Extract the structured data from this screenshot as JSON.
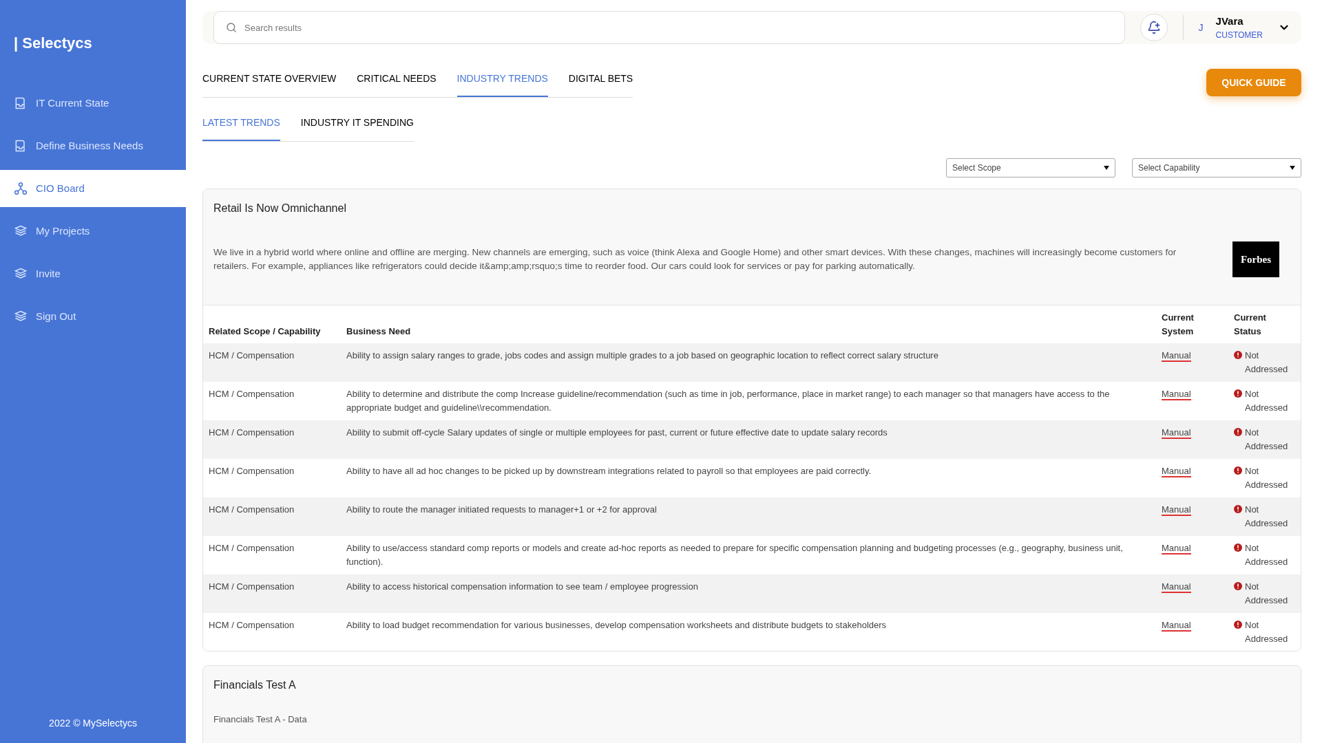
{
  "sidebar": {
    "brand": "| Selectycs",
    "items": [
      {
        "label": "IT Current State",
        "selected": false
      },
      {
        "label": "Define Business Needs",
        "selected": false
      },
      {
        "label": "CIO Board",
        "selected": true
      },
      {
        "label": "My Projects",
        "selected": false
      },
      {
        "label": "Invite",
        "selected": false
      },
      {
        "label": "Sign Out",
        "selected": false
      }
    ],
    "footer": "2022 © MySelectycs"
  },
  "header": {
    "search": {
      "placeholder": "Search results"
    },
    "user": {
      "initial": "J",
      "name": "JVara",
      "role": "CUSTOMER"
    }
  },
  "tabs": [
    {
      "label": "CURRENT STATE OVERVIEW",
      "selected": false
    },
    {
      "label": "CRITICAL NEEDS",
      "selected": false
    },
    {
      "label": "INDUSTRY TRENDS",
      "selected": true
    },
    {
      "label": "DIGITAL BETS",
      "selected": false
    }
  ],
  "quick_guide": "QUICK GUIDE",
  "subtabs": [
    {
      "label": "LATEST TRENDS",
      "selected": true
    },
    {
      "label": "INDUSTRY IT SPENDING",
      "selected": false
    }
  ],
  "filters": [
    {
      "placeholder": "Select Scope"
    },
    {
      "placeholder": "Select Capability"
    }
  ],
  "trend_card": {
    "title": "Retail Is Now Omnichannel",
    "description": "We live in a hybrid world where online and offline are merging. New channels are emerging, such as voice (think Alexa and Google Home) and other smart devices. With these changes, machines will increasingly become customers for retailers. For example, appliances like refrigerators could decide it&amp;amp;rsquo;s time to reorder food. Our cars could look for services or pay for parking automatically.",
    "source": "Forbes",
    "table": {
      "columns": [
        "Related Scope / Capability",
        "Business Need",
        "Current System",
        "Current Status"
      ],
      "rows": [
        {
          "scope": "HCM / Compensation",
          "need": "Ability to assign salary ranges to grade, jobs codes and assign multiple grades to a job based on geographic location to reflect correct salary structure",
          "system": "Manual",
          "status": "Not Addressed"
        },
        {
          "scope": "HCM / Compensation",
          "need": "Ability to determine and distribute the comp Increase guideline/recommendation (such as time in job, performance, place in market range) to each manager so that managers have access to the appropriate budget and guideline\\\\recommendation.",
          "system": "Manual",
          "status": "Not Addressed"
        },
        {
          "scope": "HCM / Compensation",
          "need": "Ability to submit off-cycle Salary updates of single or multiple employees for past, current or future effective date to update salary records",
          "system": "Manual",
          "status": "Not Addressed"
        },
        {
          "scope": "HCM / Compensation",
          "need": "Ability to have all ad hoc changes to be picked up by downstream integrations related to payroll so that employees are paid correctly.",
          "system": "Manual",
          "status": "Not Addressed"
        },
        {
          "scope": "HCM / Compensation",
          "need": "Ability to route the manager initiated requests to manager+1 or +2 for approval",
          "system": "Manual",
          "status": "Not Addressed"
        },
        {
          "scope": "HCM / Compensation",
          "need": "Ability to use/access standard comp reports or models and create ad-hoc reports as needed to prepare for specific compensation planning and budgeting processes (e.g., geography, business unit, function).",
          "system": "Manual",
          "status": "Not Addressed"
        },
        {
          "scope": "HCM / Compensation",
          "need": "Ability to access historical compensation information to see team / employee progression",
          "system": "Manual",
          "status": "Not Addressed"
        },
        {
          "scope": "HCM / Compensation",
          "need": "Ability to load budget recommendation for various businesses, develop compensation worksheets and distribute budgets to stakeholders",
          "system": "Manual",
          "status": "Not Addressed"
        }
      ]
    }
  },
  "second_card": {
    "title": "Financials Test A",
    "subtitle": "Financials Test A - Data"
  }
}
